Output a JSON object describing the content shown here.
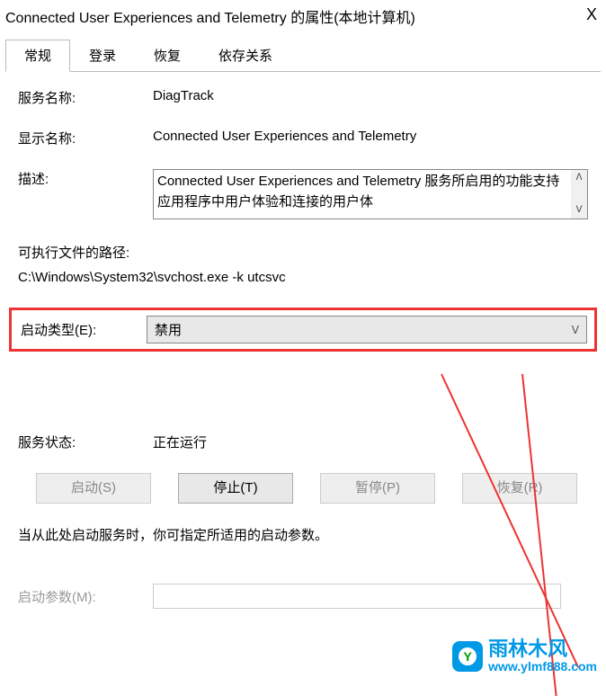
{
  "titlebar": {
    "title": "Connected User Experiences and Telemetry 的属性(本地计算机)",
    "close": "X"
  },
  "tabs": {
    "general": "常规",
    "logon": "登录",
    "recovery": "恢复",
    "dependencies": "依存关系"
  },
  "fields": {
    "service_name_label": "服务名称:",
    "service_name_value": "DiagTrack",
    "display_name_label": "显示名称:",
    "display_name_value": "Connected User Experiences and Telemetry",
    "description_label": "描述:",
    "description_value": "Connected User Experiences and Telemetry 服务所启用的功能支持应用程序中用户体验和连接的用户体",
    "exe_path_label": "可执行文件的路径:",
    "exe_path_value": "C:\\Windows\\System32\\svchost.exe -k utcsvc",
    "startup_type_label": "启动类型(E):",
    "startup_type_value": "禁用",
    "service_status_label": "服务状态:",
    "service_status_value": "正在运行",
    "hint": "当从此处启动服务时，你可指定所适用的启动参数。",
    "start_params_label": "启动参数(M):"
  },
  "buttons": {
    "start": "启动(S)",
    "stop": "停止(T)",
    "pause": "暂停(P)",
    "resume": "恢复(R)"
  },
  "watermark": {
    "brand": "雨林木风",
    "url": "www.ylmf888.com"
  }
}
